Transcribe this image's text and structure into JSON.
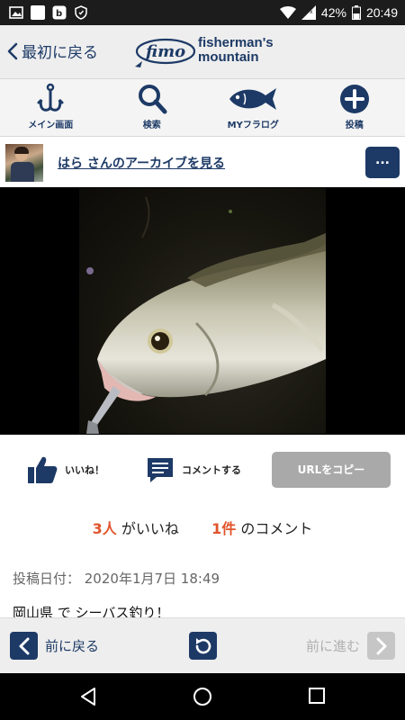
{
  "status_bar": {
    "battery": "42%",
    "time": "20:49"
  },
  "header": {
    "back_label": "最初に戻る",
    "logo_mark": "fimo",
    "logo_line1": "fisherman's",
    "logo_line2": "mountain"
  },
  "nav": {
    "items": [
      {
        "label": "メイン画面",
        "icon": "hook-icon"
      },
      {
        "label": "検索",
        "icon": "search-icon"
      },
      {
        "label": "MYフラログ",
        "icon": "fish-icon"
      },
      {
        "label": "投稿",
        "icon": "plus-circle-icon"
      }
    ]
  },
  "user": {
    "archive_link": "はら さんのアーカイブを見る",
    "more_label": "..."
  },
  "actions": {
    "like_label": "いいね！",
    "comment_label": "コメントする",
    "url_copy_label": "URLをコピー"
  },
  "stats": {
    "likes_count": "3人",
    "likes_suffix": " がいいね",
    "comments_count": "1件",
    "comments_suffix": " のコメント"
  },
  "post": {
    "date": "投稿日付： 2020年1月7日 18:49",
    "title": "岡山県 で シーバス釣り！"
  },
  "toolbar": {
    "back_label": "前に戻る",
    "forward_label": "前に進む"
  },
  "colors": {
    "brand": "#1d3a66",
    "accent": "#e0542b",
    "disabled": "#a9a9a9"
  }
}
